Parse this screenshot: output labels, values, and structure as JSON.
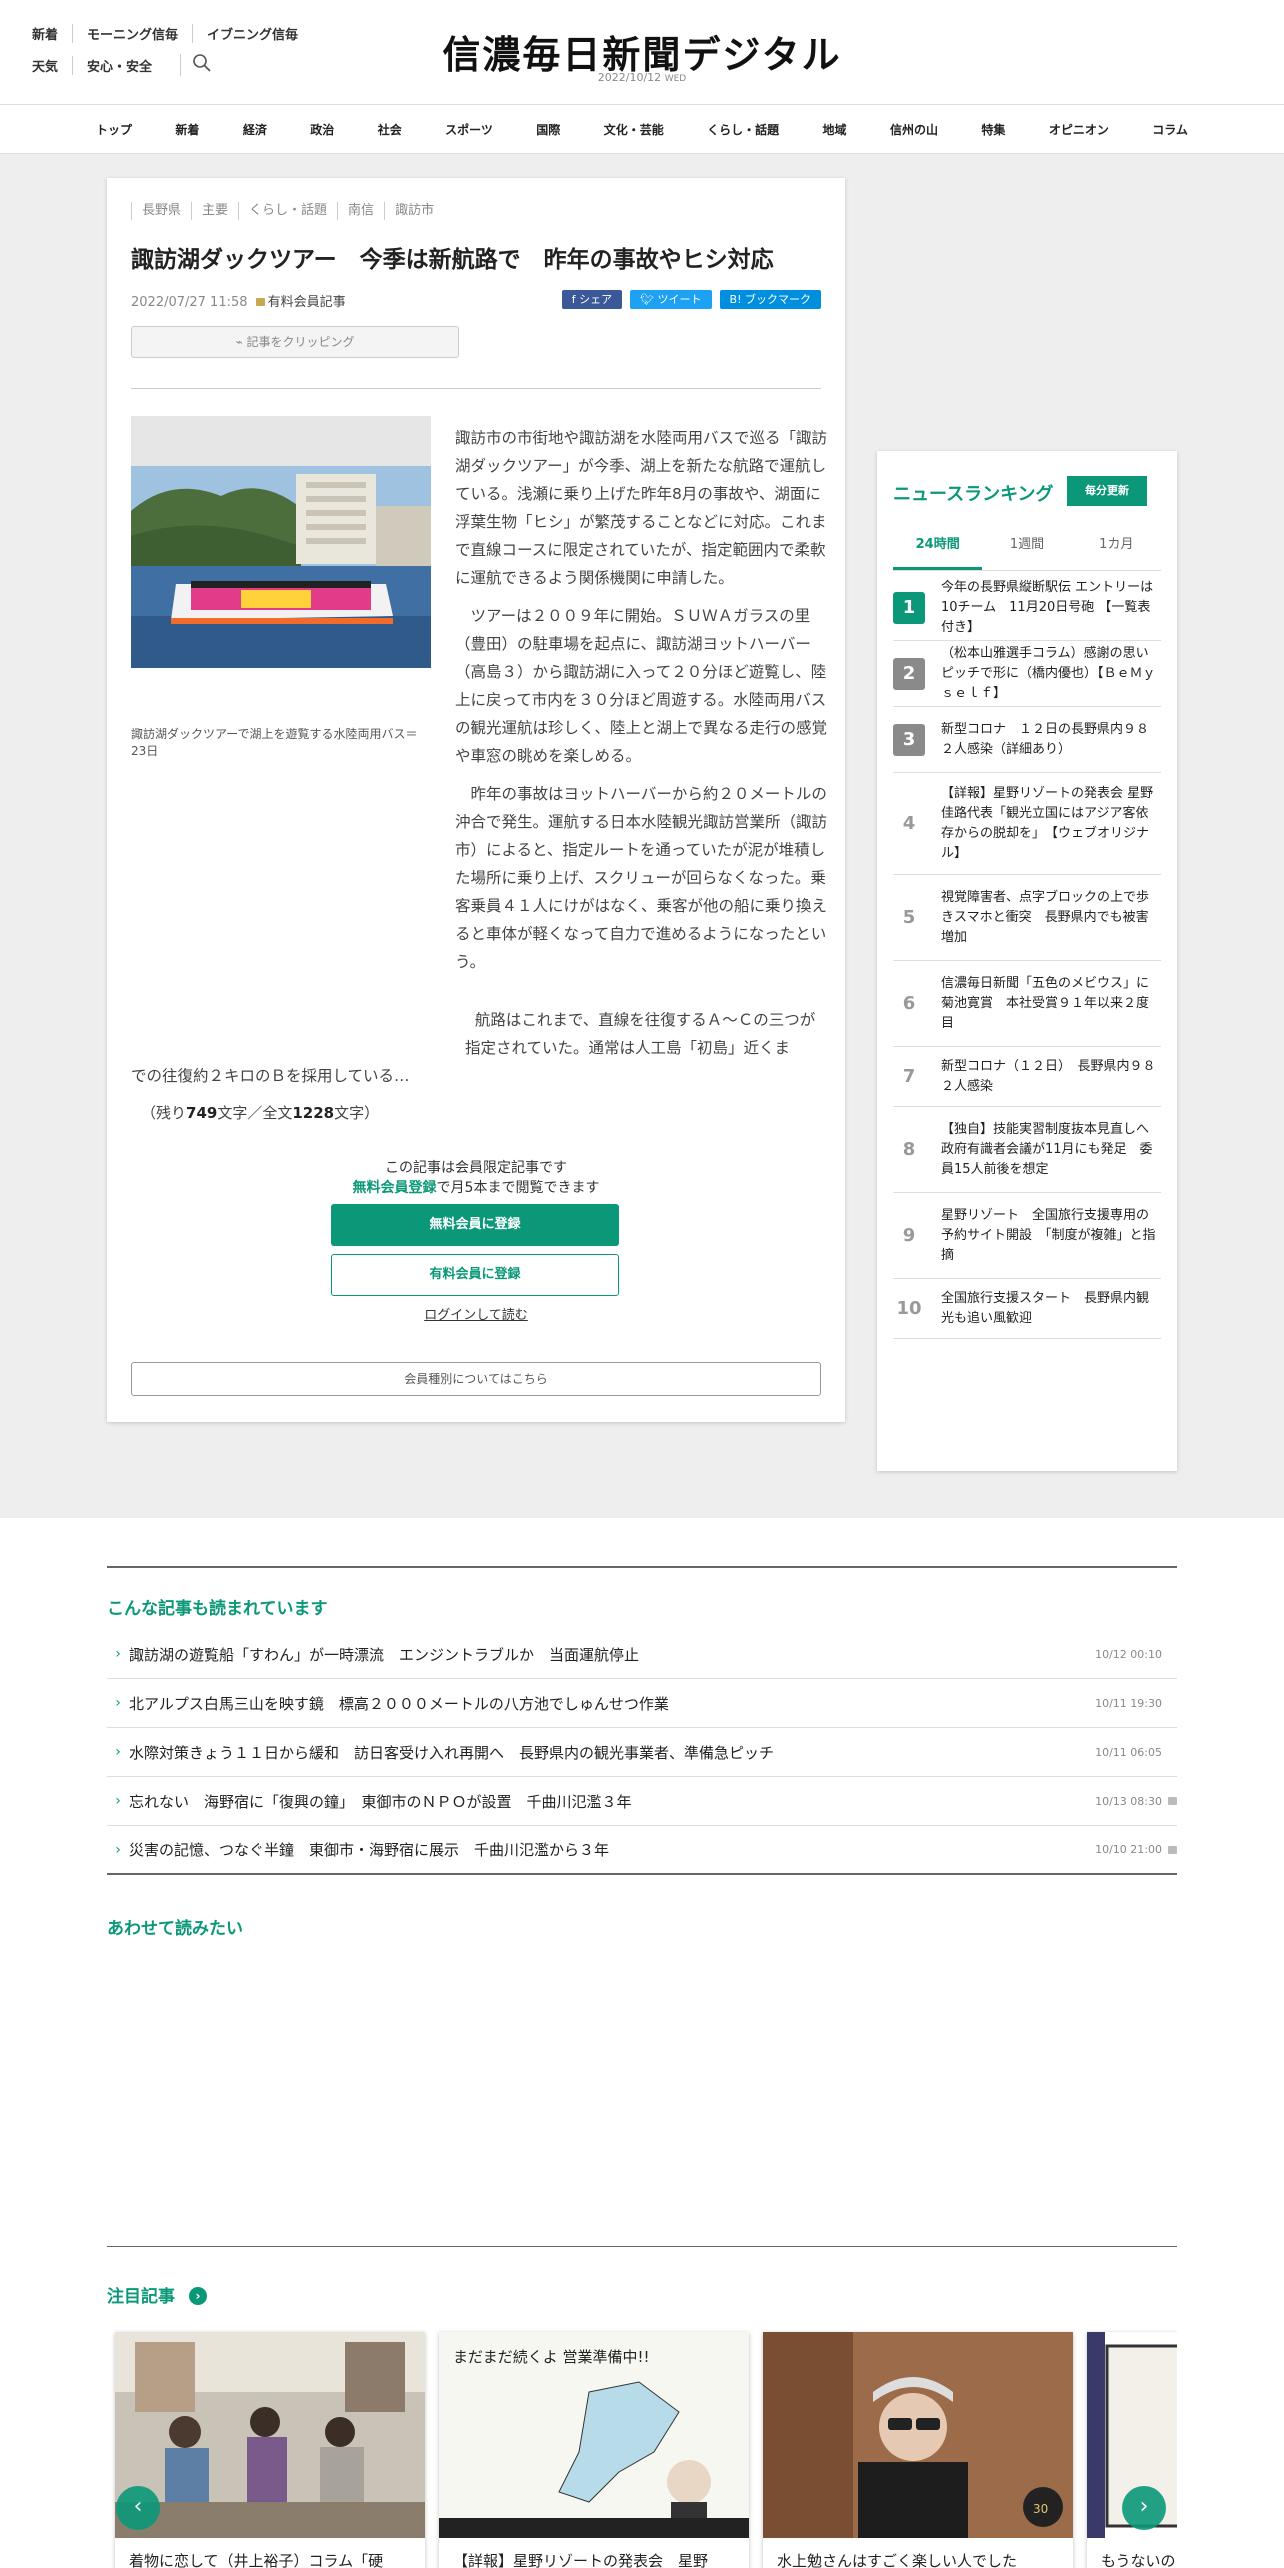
{
  "header": {
    "links_row1": [
      "新着",
      "モーニング信毎",
      "イブニング信毎"
    ],
    "links_row2": [
      "天気",
      "安心・安全"
    ],
    "logo": "信濃毎日新聞デジタル",
    "date": "2022/10/12",
    "weekday": "WED"
  },
  "nav": [
    "トップ",
    "新着",
    "経済",
    "政治",
    "社会",
    "スポーツ",
    "国際",
    "文化・芸能",
    "くらし・話題",
    "地域",
    "信州の山",
    "特集",
    "オピニオン",
    "コラム"
  ],
  "article": {
    "tags": [
      "長野県",
      "主要",
      "くらし・話題",
      "南信",
      "諏訪市"
    ],
    "title": "諏訪湖ダックツアー　今季は新航路で　昨年の事故やヒシ対応",
    "datetime": "2022/07/27 11:58",
    "member_label": "有料会員記事",
    "share": {
      "facebook": "シェア",
      "twitter": "ツイート",
      "hatena": "ブックマーク"
    },
    "clip_label": "記事をクリッピング",
    "caption": "諏訪湖ダックツアーで湖上を遊覧する水陸両用バス＝23日",
    "paragraphs": [
      "諏訪市の市街地や諏訪湖を水陸両用バスで巡る「諏訪湖ダックツアー」が今季、湖上を新たな航路で運航している。浅瀬に乗り上げた昨年8月の事故や、湖面に浮葉生物「ヒシ」が繁茂することなどに対応。これまで直線コースに限定されていたが、指定範囲内で柔軟に運航できるよう関係機関に申請した。",
      "ツアーは２００９年に開始。ＳＵＷＡガラスの里（豊田）の駐車場を起点に、諏訪湖ヨットハーバー（高島３）から諏訪湖に入って２０分ほど遊覧し、陸上に戻って市内を３０分ほど周遊する。水陸両用バスの観光運航は珍しく、陸上と湖上で異なる走行の感覚や車窓の眺めを楽しめる。",
      "昨年の事故はヨットハーバーから約２０メートルの沖合で発生。運航する日本水陸観光諏訪営業所（諏訪市）によると、指定ルートを通っていたが泥が堆積した場所に乗り上げ、スクリューが回らなくなった。乗客乗員４１人にけがはなく、乗客が他の船に乗り換えると車体が軽くなって自力で進めるようになったという。"
    ],
    "last_para_line1": "航路はこれまで、直線を往復するＡ～Ｃの三つが指定されていた。通常は人工島「初島」近くま",
    "last_para_line2": "での往復約２キロのＢを採用している…",
    "remain_prefix": "（残り",
    "remain_chars": "749",
    "remain_mid": "文字／全文",
    "total_chars": "1228",
    "remain_suffix": "文字）",
    "cta_line1": "この記事は会員限定記事です",
    "cta_free_link": "無料会員登録",
    "cta_line2_rest": "で月5本まで閲覧できます",
    "btn_free": "無料会員に登録",
    "btn_paid": "有料会員に登録",
    "login": "ログインして読む",
    "member_types": "会員種別についてはこちら"
  },
  "ranking": {
    "title": "ニュースランキング",
    "badge": "毎分更新",
    "tabs": [
      "24時間",
      "1週間",
      "1カ月"
    ],
    "items": [
      {
        "num": "1",
        "text": "今年の長野県縦断駅伝 エントリーは10チーム　11月20日号砲 【一覧表付き】"
      },
      {
        "num": "2",
        "text": "（松本山雅選手コラム）感謝の思いピッチで形に（橋内優也）【ＢｅＭｙｓｅｌｆ】"
      },
      {
        "num": "3",
        "text": "新型コロナ　１２日の長野県内９８２人感染（詳細あり）"
      },
      {
        "num": "4",
        "text": "【詳報】星野リゾートの発表会 星野佳路代表「観光立国にはアジア客依存からの脱却を」　【ウェブオリジナル】"
      },
      {
        "num": "5",
        "text": "視覚障害者、点字ブロックの上で歩きスマホと衝突　長野県内でも被害増加"
      },
      {
        "num": "6",
        "text": "信濃毎日新聞「五色のメビウス」に菊池寛賞　本社受賞９１年以来２度目"
      },
      {
        "num": "7",
        "text": "新型コロナ（１２日）　長野県内９８２人感染"
      },
      {
        "num": "8",
        "text": "【独自】技能実習制度抜本見直しへ　政府有識者会議が11月にも発足　委員15人前後を想定"
      },
      {
        "num": "9",
        "text": "星野リゾート　全国旅行支援専用の予約サイト開設　「制度が複雑」と指摘"
      },
      {
        "num": "10",
        "text": "全国旅行支援スタート　長野県内観光も追い風歓迎"
      }
    ]
  },
  "related": {
    "title": "こんな記事も読まれています",
    "items": [
      {
        "text": "諏訪湖の遊覧船「すわん」が一時漂流　エンジントラブルか　当面運航停止",
        "date": "10/12 00:10",
        "locked": false
      },
      {
        "text": "北アルプス白馬三山を映す鏡　標高２０００メートルの八方池でしゅんせつ作業",
        "date": "10/11 19:30",
        "locked": false
      },
      {
        "text": "水際対策きょう１１日から緩和　訪日客受け入れ再開へ　長野県内の観光事業者、準備急ピッチ",
        "date": "10/11 06:05",
        "locked": false
      },
      {
        "text": "忘れない　海野宿に「復興の鐘」　東御市のＮＰＯが設置　千曲川氾濫３年",
        "date": "10/13 08:30",
        "locked": true
      },
      {
        "text": "災害の記憶、つなぐ半鐘　東御市・海野宿に展示　千曲川氾濫から３年",
        "date": "10/10 21:00",
        "locked": true
      }
    ]
  },
  "also_read": {
    "title": "あわせて読みたい"
  },
  "featured": {
    "title": "注目記事",
    "cards": [
      {
        "caption": "着物に恋して（井上裕子）コラム「硬"
      },
      {
        "caption": "【詳報】星野リゾートの発表会　星野"
      },
      {
        "caption": "水上勉さんはすごく楽しい人でした"
      },
      {
        "caption": "もうないの"
      }
    ],
    "image_text_2": "まだまだ続くよ 営業準備中!!",
    "image_text_3": "30"
  },
  "colors": {
    "accent": "#0b9878",
    "band": "#eeeeee"
  }
}
